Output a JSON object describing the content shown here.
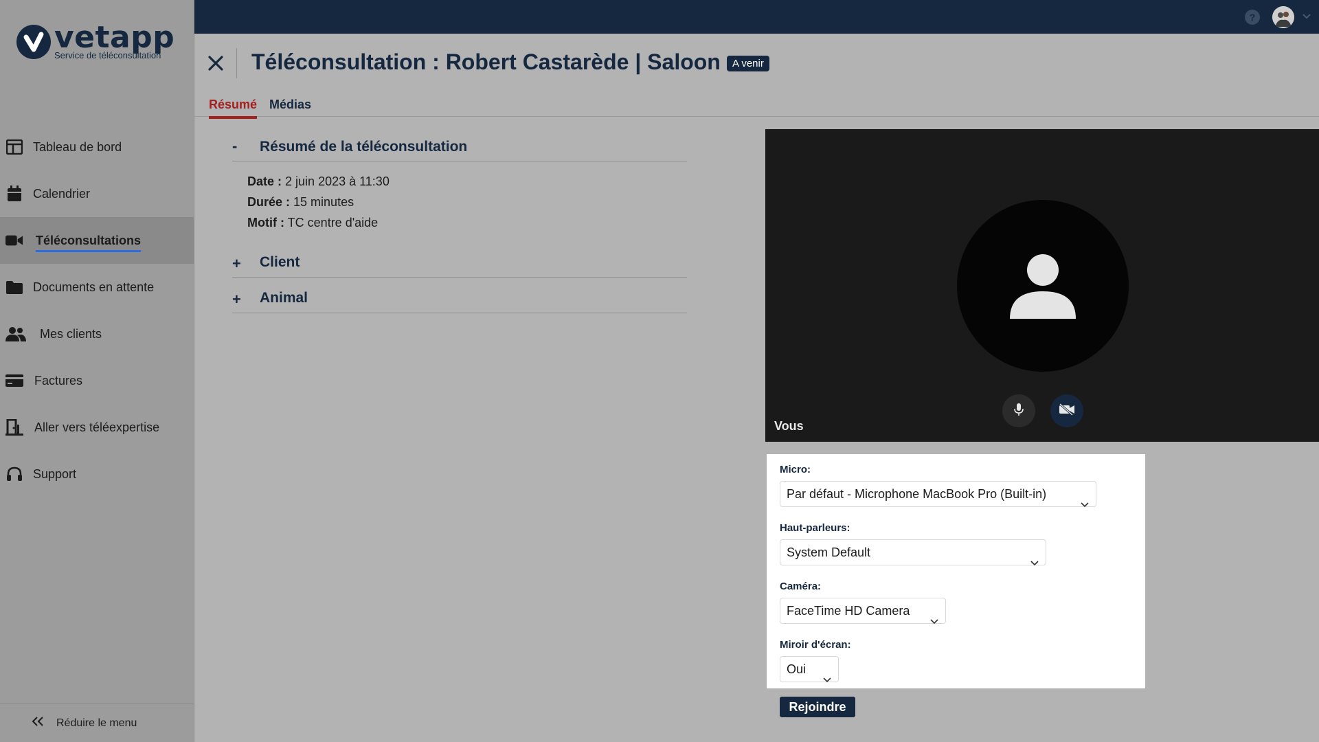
{
  "brand": {
    "name": "vetapp",
    "tagline": "Service de téléconsultation"
  },
  "sidebar": {
    "items": [
      {
        "label": "Tableau de bord",
        "icon": "dashboard-icon"
      },
      {
        "label": "Calendrier",
        "icon": "calendar-icon"
      },
      {
        "label": "Téléconsultations",
        "icon": "video-camera-icon",
        "active": true
      },
      {
        "label": "Documents en attente",
        "icon": "folder-icon"
      },
      {
        "label": "Mes clients",
        "icon": "users-icon"
      },
      {
        "label": "Factures",
        "icon": "credit-card-icon"
      },
      {
        "label": "Aller vers téléexpertise",
        "icon": "door-exit-icon"
      },
      {
        "label": "Support",
        "icon": "headset-icon"
      }
    ],
    "collapse_label": "Réduire le menu"
  },
  "topbar": {
    "help": "?"
  },
  "header": {
    "title": "Téléconsultation : Robert Castarède | Saloon",
    "status": "A venir"
  },
  "tabs": [
    {
      "label": "Résumé",
      "active": true
    },
    {
      "label": "Médias",
      "active": false
    }
  ],
  "summary": {
    "title": "Résumé de la téléconsultation",
    "toggle": "-",
    "date_label": "Date :",
    "date_value": "2 juin 2023 à 11:30",
    "duration_label": "Durée :",
    "duration_value": "15 minutes",
    "reason_label": "Motif :",
    "reason_value": "TC centre d'aide"
  },
  "sections": [
    {
      "title": "Client",
      "toggle": "+"
    },
    {
      "title": "Animal",
      "toggle": "+"
    }
  ],
  "video": {
    "self_label": "Vous"
  },
  "devices": {
    "micro_label": "Micro:",
    "micro_value": "Par défaut - Microphone MacBook Pro (Built-in)",
    "speakers_label": "Haut-parleurs:",
    "speakers_value": "System Default",
    "camera_label": "Caméra:",
    "camera_value": "FaceTime HD Camera",
    "mirror_label": "Miroir d'écran:",
    "mirror_value": "Oui"
  },
  "join_label": "Rejoindre",
  "colors": {
    "navy": "#15283f",
    "accent_red": "#a32020",
    "active_underline": "#2d6cdf"
  }
}
